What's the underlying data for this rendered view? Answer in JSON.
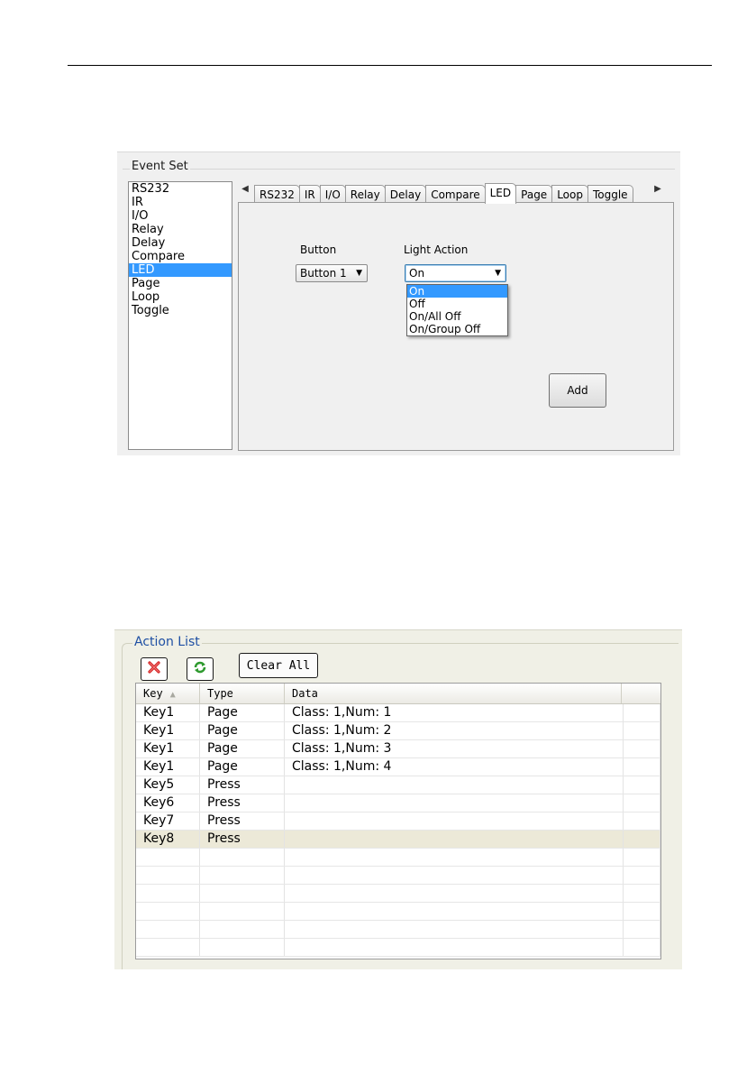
{
  "page": {
    "number": ""
  },
  "event_set": {
    "title": "Event Set",
    "list_items": [
      "RS232",
      "IR",
      "I/O",
      "Relay",
      "Delay",
      "Compare",
      "LED",
      "Page",
      "Loop",
      "Toggle"
    ],
    "selected_index": 6,
    "tabs": [
      "RS232",
      "IR",
      "I/O",
      "Relay",
      "Delay",
      "Compare",
      "LED",
      "Page",
      "Loop",
      "Toggle"
    ],
    "active_tab": "LED",
    "button_label": "Button",
    "button_value": "Button 1",
    "light_action_label": "Light Action",
    "light_action_value": "On",
    "light_action_options": [
      "On",
      "Off",
      "On/All Off",
      "On/Group Off"
    ],
    "light_action_selected": 0,
    "add_label": "Add"
  },
  "action_list": {
    "title": "Action List",
    "clear_all_label": "Clear All",
    "columns": [
      "Key",
      "Type",
      "Data"
    ],
    "rows": [
      {
        "key": "Key1",
        "type": "Page",
        "data": "Class: 1,Num: 1"
      },
      {
        "key": "Key1",
        "type": "Page",
        "data": "Class: 1,Num: 2"
      },
      {
        "key": "Key1",
        "type": "Page",
        "data": "Class: 1,Num: 3"
      },
      {
        "key": "Key1",
        "type": "Page",
        "data": "Class: 1,Num: 4"
      },
      {
        "key": "Key5",
        "type": "Press",
        "data": ""
      },
      {
        "key": "Key6",
        "type": "Press",
        "data": ""
      },
      {
        "key": "Key7",
        "type": "Press",
        "data": ""
      },
      {
        "key": "Key8",
        "type": "Press",
        "data": ""
      }
    ],
    "selected_row": 7,
    "empty_rows": 6
  },
  "colors": {
    "selection": "#3399ff",
    "title_blue": "#1e4fa3",
    "row_selected": "#ece9d8"
  }
}
